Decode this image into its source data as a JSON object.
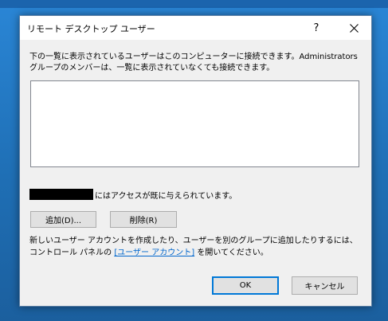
{
  "dialog": {
    "title": "リモート デスクトップ ユーザー",
    "help_label": "?",
    "description": "下の一覧に表示されているユーザーはこのコンピューターに接続できます。Administrators グループのメンバーは、一覧に表示されていなくても接続できます。",
    "access_suffix": "にはアクセスが既に与えられています。",
    "add_label": "追加(D)...",
    "remove_label": "削除(R)",
    "note_before": "新しいユーザー アカウントを作成したり、ユーザーを別のグループに追加したりするには、コントロール パネルの ",
    "note_link": "[ユーザー アカウント]",
    "note_after": " を開いてください。",
    "ok_label": "OK",
    "cancel_label": "キャンセル"
  },
  "colors": {
    "link": "#0066cc",
    "default_button_border": "#0078d7",
    "desktop": "#1f6fb5"
  }
}
